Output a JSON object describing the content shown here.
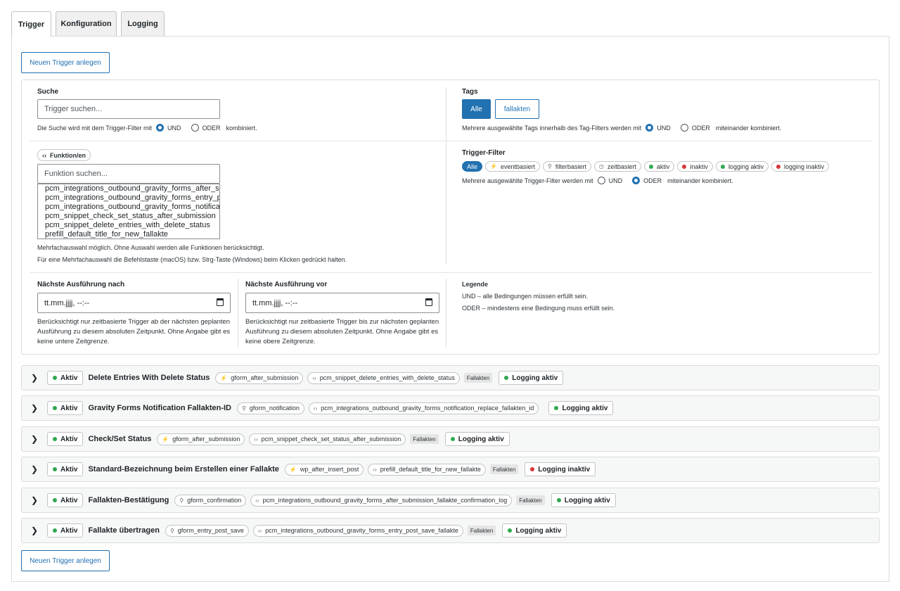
{
  "tabs": [
    "Trigger",
    "Konfiguration",
    "Logging"
  ],
  "new_trigger_label": "Neuen Trigger anlegen",
  "search": {
    "label": "Suche",
    "placeholder": "Trigger suchen...",
    "hint_before": "Die Suche wird mit dem Trigger-Filter mit",
    "und": "UND",
    "oder": "ODER",
    "hint_after": "kombiniert."
  },
  "tags": {
    "label": "Tags",
    "all": "Alle",
    "fallakten": "fallakten",
    "hint_before": "Mehrere ausgewählte Tags innerhalb des Tag-Filters werden mit",
    "und": "UND",
    "oder": "ODER",
    "hint_after": "miteinander kombiniert."
  },
  "functions": {
    "chip_label": "Funktion/en",
    "placeholder": "Funktion suchen...",
    "options": [
      "pcm_integrations_outbound_gravity_forms_after_s",
      "pcm_integrations_outbound_gravity_forms_entry_p",
      "pcm_integrations_outbound_gravity_forms_notifica",
      "pcm_snippet_check_set_status_after_submission",
      "pcm_snippet_delete_entries_with_delete_status",
      "prefill_default_title_for_new_fallakte"
    ],
    "hint1": "Mehrfachauswahl möglich. Ohne Auswahl werden alle Funktionen berücksichtigt.",
    "hint2": "Für eine Mehrfachauswahl die Befehlstaste (macOS) bzw. Strg-Taste (Windows) beim Klicken gedrückt halten."
  },
  "trigger_filter": {
    "label": "Trigger-Filter",
    "chips": [
      {
        "label": "Alle",
        "icon": "",
        "selected": true
      },
      {
        "label": "eventbasiert",
        "icon": "⚡",
        "selected": false
      },
      {
        "label": "filterbasiert",
        "icon": "⚲",
        "selected": false
      },
      {
        "label": "zeitbasiert",
        "icon": "◷",
        "selected": false
      },
      {
        "label": "aktiv",
        "icon": "dot-green",
        "selected": false
      },
      {
        "label": "inaktiv",
        "icon": "dot-red",
        "selected": false
      },
      {
        "label": "logging aktiv",
        "icon": "dot-green",
        "selected": false
      },
      {
        "label": "logging inaktiv",
        "icon": "dot-red",
        "selected": false
      }
    ],
    "hint_before": "Mehrere ausgewählte Trigger-Filter werden mit",
    "und": "UND",
    "oder": "ODER",
    "hint_after": "miteinander kombiniert."
  },
  "next_after": {
    "label": "Nächste Ausführung nach",
    "value": "tt.mm.jjjj, --:--",
    "hint": "Berücksichtigt nur zeitbasierte Trigger ab der nächsten geplanten Ausführung zu diesem absoluten Zeitpunkt. Ohne Angabe gibt es keine untere Zeitgrenze."
  },
  "next_before": {
    "label": "Nächste Ausführung vor",
    "value": "tt.mm.jjjj, --:--",
    "hint": "Berücksichtigt nur zeitbasierte Trigger bis zur nächsten geplanten Ausführung zu diesem absoluten Zeitpunkt. Ohne Angabe gibt es keine obere Zeitgrenze."
  },
  "legend": {
    "label": "Legende",
    "line1": "UND – alle Bedingungen müssen erfüllt sein.",
    "line2": "ODER – mindestens eine Bedingung muss erfüllt sein."
  },
  "triggers": [
    {
      "status": "Aktiv",
      "title": "Delete Entries With Delete Status",
      "hook_icon": "⚡",
      "hook": "gform_after_submission",
      "func": "pcm_snippet_delete_entries_with_delete_status",
      "tag": "Fallakten",
      "logging": "Logging aktiv",
      "logging_on": true
    },
    {
      "status": "Aktiv",
      "title": "Gravity Forms Notification Fallakten-ID",
      "hook_icon": "⚲",
      "hook": "gform_notification",
      "func": "pcm_integrations_outbound_gravity_forms_notification_replace_fallakten_id",
      "tag": "",
      "logging": "Logging aktiv",
      "logging_on": true
    },
    {
      "status": "Aktiv",
      "title": "Check/Set Status",
      "hook_icon": "⚡",
      "hook": "gform_after_submission",
      "func": "pcm_snippet_check_set_status_after_submission",
      "tag": "Fallakten",
      "logging": "Logging aktiv",
      "logging_on": true
    },
    {
      "status": "Aktiv",
      "title": "Standard-Bezeichnung beim Erstellen einer Fallakte",
      "hook_icon": "⚡",
      "hook": "wp_after_insert_post",
      "func": "prefill_default_title_for_new_fallakte",
      "tag": "Fallakten",
      "logging": "Logging inaktiv",
      "logging_on": false
    },
    {
      "status": "Aktiv",
      "title": "Fallakten-Bestätigung",
      "hook_icon": "⚲",
      "hook": "gform_confirmation",
      "func": "pcm_integrations_outbound_gravity_forms_after_submission_fallakte_confirmation_log",
      "tag": "Fallakten",
      "logging": "Logging aktiv",
      "logging_on": true
    },
    {
      "status": "Aktiv",
      "title": "Fallakte übertragen",
      "hook_icon": "⚲",
      "hook": "gform_entry_post_save",
      "func": "pcm_integrations_outbound_gravity_forms_entry_post_save_fallakte",
      "tag": "Fallakten",
      "logging": "Logging aktiv",
      "logging_on": true
    }
  ],
  "colors": {
    "accent": "#2271b1",
    "green": "#2fa84f",
    "red": "#d63638"
  }
}
